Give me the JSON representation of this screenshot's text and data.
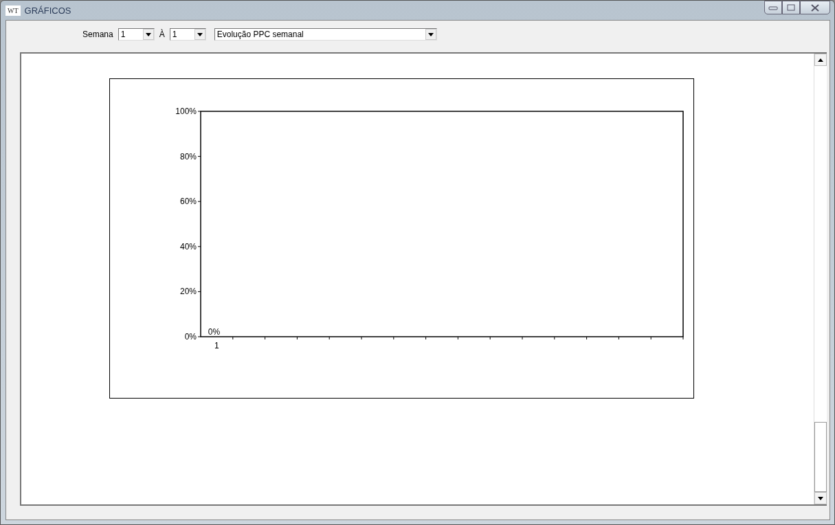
{
  "window": {
    "title": "GRÁFICOS",
    "logo": "WT"
  },
  "toolbar": {
    "week_from_label": "Semana",
    "week_from": "1",
    "week_to_label": "À",
    "week_to": "1",
    "chart_select": "Evolução PPC semanal"
  },
  "chart": {
    "chart_data": {
      "type": "bar",
      "categories": [
        "1"
      ],
      "values": [
        0
      ],
      "value_labels": [
        "0%"
      ],
      "ylim": [
        0,
        100
      ],
      "yticks": [
        {
          "value": 0,
          "label": "0%"
        },
        {
          "value": 20,
          "label": "20%"
        },
        {
          "value": 40,
          "label": "40%"
        },
        {
          "value": 60,
          "label": "60%"
        },
        {
          "value": 80,
          "label": "80%"
        },
        {
          "value": 100,
          "label": "100%"
        }
      ]
    }
  }
}
